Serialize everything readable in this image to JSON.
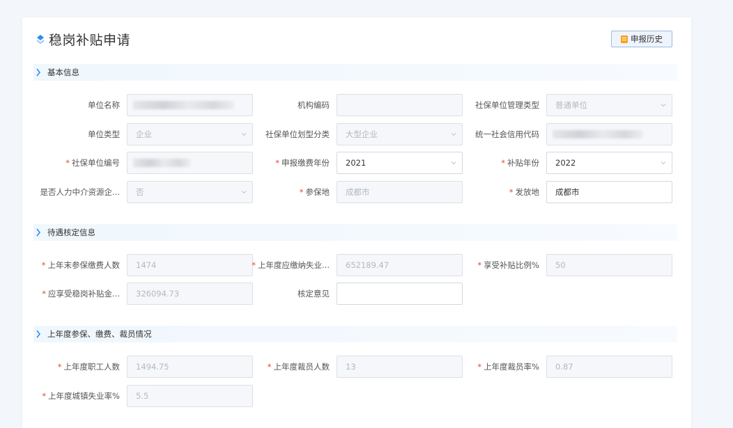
{
  "page": {
    "title": "稳岗补贴申请",
    "history_button": "申报历史"
  },
  "sections": {
    "basic": "基本信息",
    "review": "待遇核定信息",
    "lastyear": "上年度参保、缴费、裁员情况"
  },
  "basic": {
    "unit_name": {
      "label": "单位名称",
      "value": ""
    },
    "org_code": {
      "label": "机构编码",
      "value": ""
    },
    "mgmt_type": {
      "label": "社保单位管理类型",
      "value": "普通单位"
    },
    "unit_type": {
      "label": "单位类型",
      "value": "企业"
    },
    "size_class": {
      "label": "社保单位划型分类",
      "value": "大型企业"
    },
    "credit_code": {
      "label": "统一社会信用代码",
      "value": ""
    },
    "unit_no": {
      "label": "社保单位编号",
      "value": "",
      "required": "*"
    },
    "fee_year": {
      "label": "申报缴费年份",
      "value": "2021",
      "required": "*"
    },
    "subsidy_year": {
      "label": "补贴年份",
      "value": "2022",
      "required": "*"
    },
    "hr_agency": {
      "label": "是否人力中介资源企...",
      "value": "否"
    },
    "insured_place": {
      "label": "参保地",
      "value": "成都市",
      "required": "*"
    },
    "issue_place": {
      "label": "发放地",
      "value": "成都市",
      "required": "*"
    }
  },
  "review": {
    "insured_count": {
      "label": "上年末参保缴费人数",
      "value": "1474",
      "required": "*"
    },
    "unemp_paid": {
      "label": "上年度应缴纳失业...",
      "value": "652189.47",
      "required": "*"
    },
    "subsidy_ratio": {
      "label": "享受补贴比例%",
      "value": "50",
      "required": "*"
    },
    "subsidy_amount": {
      "label": "应享受稳岗补贴金...",
      "value": "326094.73",
      "required": "*"
    },
    "opinion": {
      "label": "核定意见",
      "value": ""
    }
  },
  "lastyear": {
    "staff_count": {
      "label": "上年度职工人数",
      "value": "1494.75",
      "required": "*"
    },
    "layoff_count": {
      "label": "上年度裁员人数",
      "value": "13",
      "required": "*"
    },
    "layoff_rate": {
      "label": "上年度裁员率%",
      "value": "0.87",
      "required": "*"
    },
    "urban_unemp_rate": {
      "label": "上年度城镇失业率%",
      "value": "5.5",
      "required": "*"
    }
  },
  "colors": {
    "accent": "#2d8cf0",
    "required": "#e0473b",
    "history_icon": "#f5a623"
  },
  "icons": {
    "title": "diamond-stack-icon",
    "history": "document-icon",
    "section": "chevron-right-icon",
    "select": "chevron-down-icon"
  }
}
